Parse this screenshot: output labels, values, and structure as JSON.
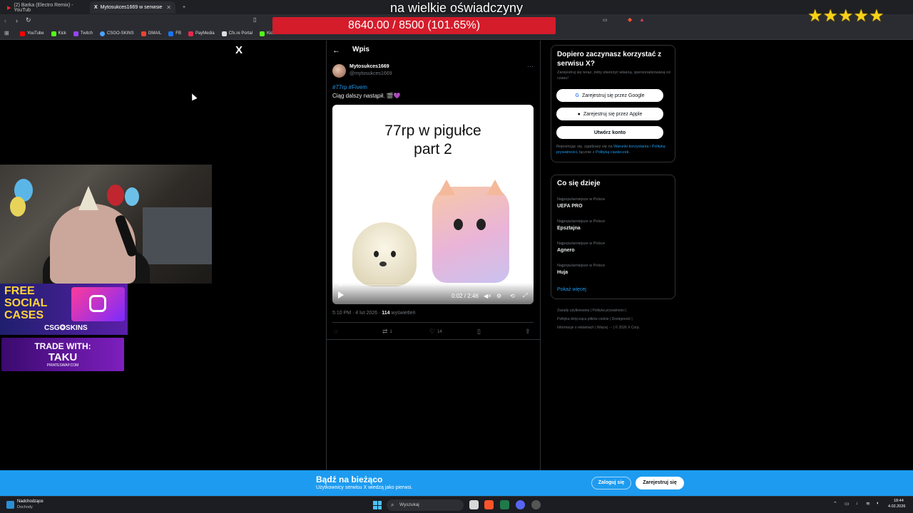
{
  "browser": {
    "tabs": [
      {
        "label": "(2) Barka (Electro Remix) - YouTub"
      },
      {
        "label": "Mytosukces1669 w serwisie X: „#"
      }
    ],
    "bookmarks": [
      "YouTube",
      "Kick",
      "Twitch",
      "CSGO-SKINS",
      "GMAIL",
      "FB",
      "PayMedia",
      "Cfx.re Portal",
      "Kick Dashboard"
    ]
  },
  "overlay": {
    "title": "na wielkie oświadczyny",
    "goal": "8640.00 / 8500 (101.65%)",
    "stars": "★★★★★"
  },
  "x_logo": "X",
  "ads": {
    "free_social": "FREE\nSOCIAL\nCASES",
    "csg": "CSG✪SKINS",
    "trade_line1": "TRADE WITH:",
    "trade_line2": "TAKU",
    "trade_url": "PIRATESWAP.COM"
  },
  "post": {
    "header": "Wpis",
    "author_name": "Mytosukces1669",
    "author_handle": "@mytosukces1669",
    "hashtags": "#77rp #Fivem",
    "text": "Ciąg dalszy nastąpił. 🎬💜",
    "video_title_line1": "77rp w pigułce",
    "video_title_line2": "part 2",
    "video_time": "0:02 / 2:46",
    "video_progress": 0.012,
    "time": "5:10 PM · 4 lut 2026 · ",
    "views": "114",
    "views_label": " wyświetleń",
    "retweets": "1",
    "likes": "14"
  },
  "signup": {
    "title": "Dopiero zaczynasz korzystać z serwisu X?",
    "subtitle": "Zarejestruj się teraz, żeby stworzyć własną, spersonalizowaną oś czasu!",
    "google": "Zarejestruj się przez Google",
    "apple": "Zarejestruj się przez Apple",
    "create": "Utwórz konto",
    "legal_1": "Rejestrując się, zgadzasz się na ",
    "legal_terms": "Warunki korzystania",
    "legal_2": " i ",
    "legal_privacy": "Politykę prywatności",
    "legal_3": ", łącznie z ",
    "legal_cookies": "Polityką ciasteczek",
    "legal_4": "."
  },
  "trends": {
    "title": "Co się dzieje",
    "items": [
      {
        "context": "Najpopularniejsze w Polsce",
        "name": "UEFA PRO"
      },
      {
        "context": "Najpopularniejsze w Polsce",
        "name": "Epsztajna"
      },
      {
        "context": "Najpopularniejsze w Polsce",
        "name": "Agnero"
      },
      {
        "context": "Najpopularniejsze w Polsce",
        "name": "Huja"
      }
    ],
    "show_more": "Pokaż więcej"
  },
  "footer": {
    "line1": "Zasady użytkowania  |  Polityka prywatności  |",
    "line2": "Polityka dotycząca plików cookie  |  Dostępność  |",
    "line3": "Informacje o reklamach  |  Więcej ···  |  © 2026 X Corp."
  },
  "banner": {
    "title": "Bądź na bieżąco",
    "subtitle": "Użytkownicy serwisu X wiedzą jako pierwsi.",
    "login": "Zaloguj się",
    "register": "Zarejestruj się"
  },
  "taskbar": {
    "weather_title": "Nadchodzące",
    "weather_sub": "Dochody",
    "search_placeholder": "Wyszukaj",
    "time": "18:44",
    "date": "4.02.2026"
  },
  "colors": {
    "accent": "#1d9bf0",
    "goal_bar": "#d41c2b",
    "stars": "#f7d21a"
  }
}
